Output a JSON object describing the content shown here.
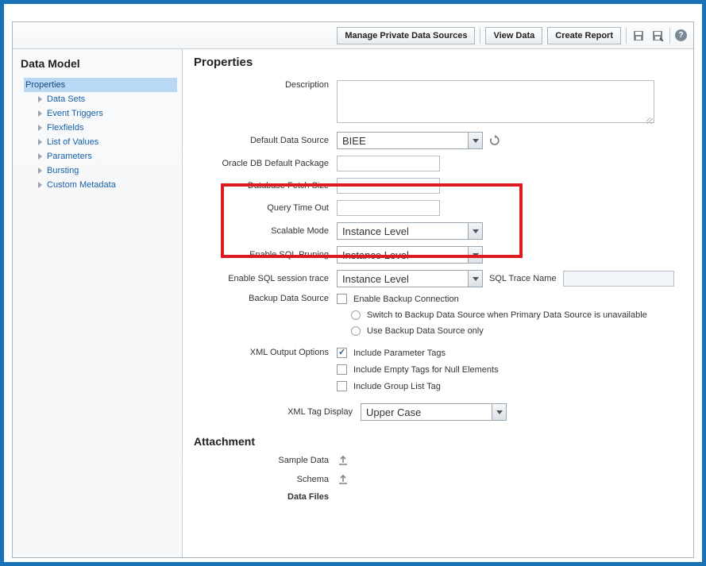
{
  "toolbar": {
    "manage_sources": "Manage Private Data Sources",
    "view_data": "View Data",
    "create_report": "Create Report"
  },
  "sidebar": {
    "title": "Data Model",
    "items": [
      {
        "label": "Properties"
      },
      {
        "label": "Data Sets"
      },
      {
        "label": "Event Triggers"
      },
      {
        "label": "Flexfields"
      },
      {
        "label": "List of Values"
      },
      {
        "label": "Parameters"
      },
      {
        "label": "Bursting"
      },
      {
        "label": "Custom Metadata"
      }
    ]
  },
  "properties": {
    "heading": "Properties",
    "labels": {
      "description": "Description",
      "default_ds": "Default Data Source",
      "oracle_pkg": "Oracle DB Default Package",
      "fetch_size": "Database Fetch Size",
      "query_timeout": "Query Time Out",
      "scalable_mode": "Scalable Mode",
      "sql_pruning": "Enable SQL Pruning",
      "sql_trace": "Enable SQL session trace",
      "sql_trace_name": "SQL Trace Name",
      "backup_ds": "Backup Data Source",
      "xml_output": "XML Output Options",
      "xml_tag_display": "XML Tag Display"
    },
    "values": {
      "description": "",
      "default_ds": "BIEE",
      "oracle_pkg": "",
      "fetch_size": "",
      "query_timeout": "",
      "scalable_mode": "Instance Level",
      "sql_pruning": "Instance Level",
      "sql_trace": "Instance Level",
      "sql_trace_name": "",
      "xml_tag_display": "Upper Case"
    },
    "backup": {
      "enable_conn": "Enable Backup Connection",
      "switch": "Switch to Backup Data Source when Primary Data Source is unavailable",
      "only": "Use Backup Data Source only"
    },
    "xml_opts": {
      "param_tags": "Include Parameter Tags",
      "empty_tags": "Include Empty Tags for Null Elements",
      "group_list": "Include Group List Tag"
    }
  },
  "attachment": {
    "heading": "Attachment",
    "labels": {
      "sample_data": "Sample Data",
      "schema": "Schema",
      "data_files": "Data Files"
    }
  }
}
